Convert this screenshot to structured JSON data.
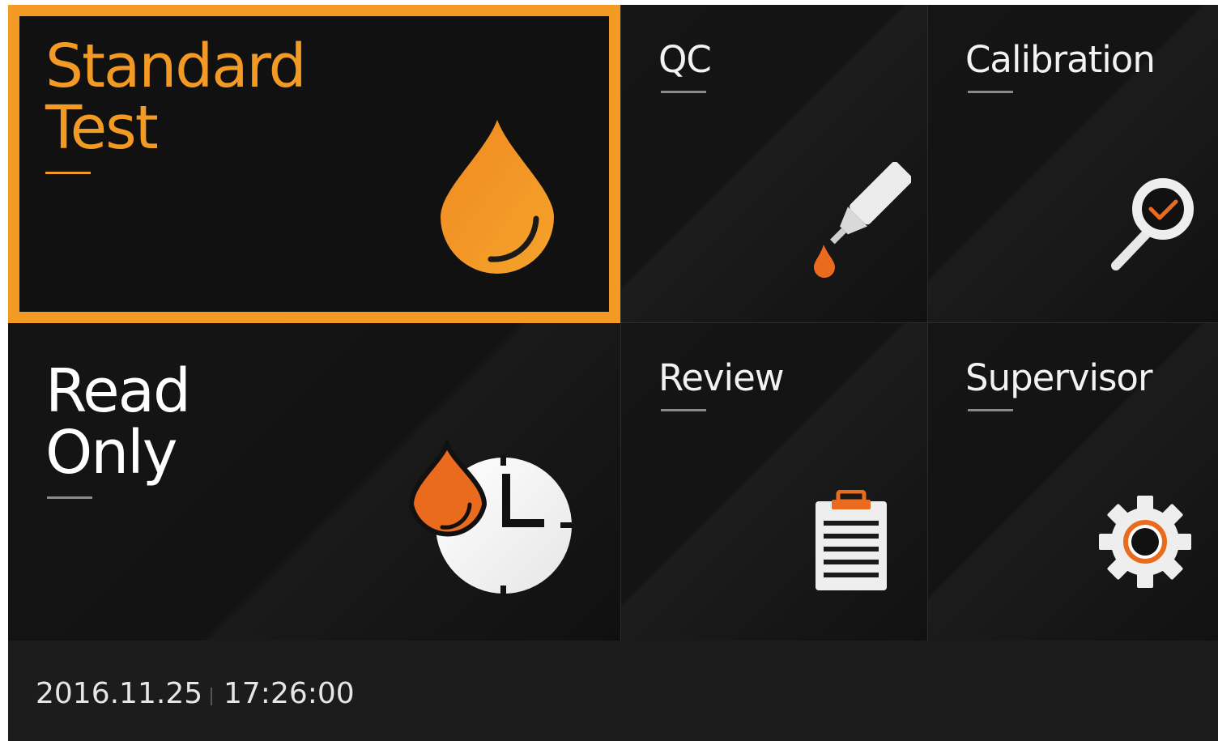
{
  "tiles": {
    "standard_test": {
      "line1": "Standard",
      "line2": "Test",
      "icon": "drop-icon",
      "selected": true
    },
    "qc": {
      "label": "QC",
      "icon": "dropper-icon"
    },
    "calibration": {
      "label": "Calibration",
      "icon": "magnifier-check-icon"
    },
    "read_only": {
      "line1": "Read",
      "line2": "Only",
      "icon": "drop-clock-icon"
    },
    "review": {
      "label": "Review",
      "icon": "clipboard-icon"
    },
    "supervisor": {
      "label": "Supervisor",
      "icon": "gear-icon"
    }
  },
  "status": {
    "date": "2016.11.25",
    "time": "17:26:00"
  },
  "colors": {
    "accent": "#f29a24",
    "accent_dark": "#ea6a1e",
    "background": "#121212",
    "statusbar": "#1c1c1c",
    "text": "#ffffff"
  }
}
